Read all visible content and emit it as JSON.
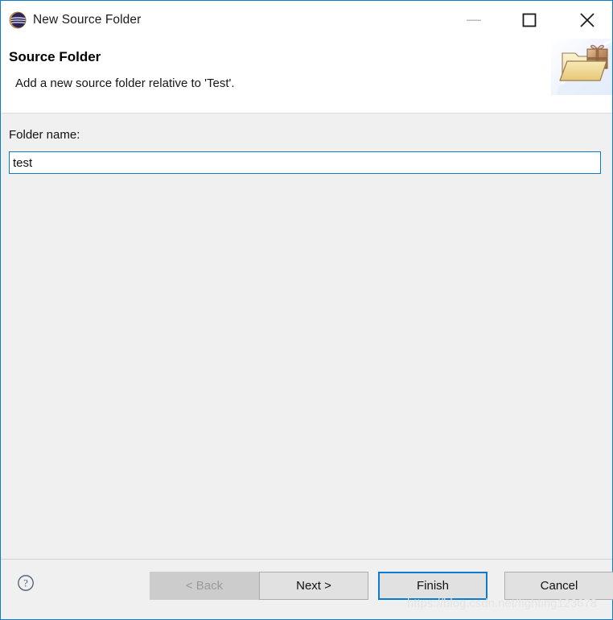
{
  "window": {
    "title": "New Source Folder",
    "app_icon": "eclipse-icon",
    "accent_color": "#0a7bd1",
    "controls": {
      "minimize": "minimize-icon",
      "maximize": "maximize-icon",
      "close": "close-icon"
    }
  },
  "header": {
    "title": "Source Folder",
    "description": "Add a new source folder relative to 'Test'.",
    "banner_icon": "folder-with-gift-icon"
  },
  "form": {
    "folder_name_label": "Folder name:",
    "folder_name_value": "test",
    "folder_name_placeholder": ""
  },
  "footer": {
    "help_icon": "help-question-icon",
    "buttons": [
      {
        "name": "back",
        "label": "< Back",
        "enabled": false,
        "default": false
      },
      {
        "name": "next",
        "label": "Next >",
        "enabled": true,
        "default": false
      },
      {
        "name": "finish",
        "label": "Finish",
        "enabled": true,
        "default": true
      },
      {
        "name": "cancel",
        "label": "Cancel",
        "enabled": true,
        "default": false
      }
    ]
  },
  "watermark": "https://blog.csdn.net/fighting123678"
}
